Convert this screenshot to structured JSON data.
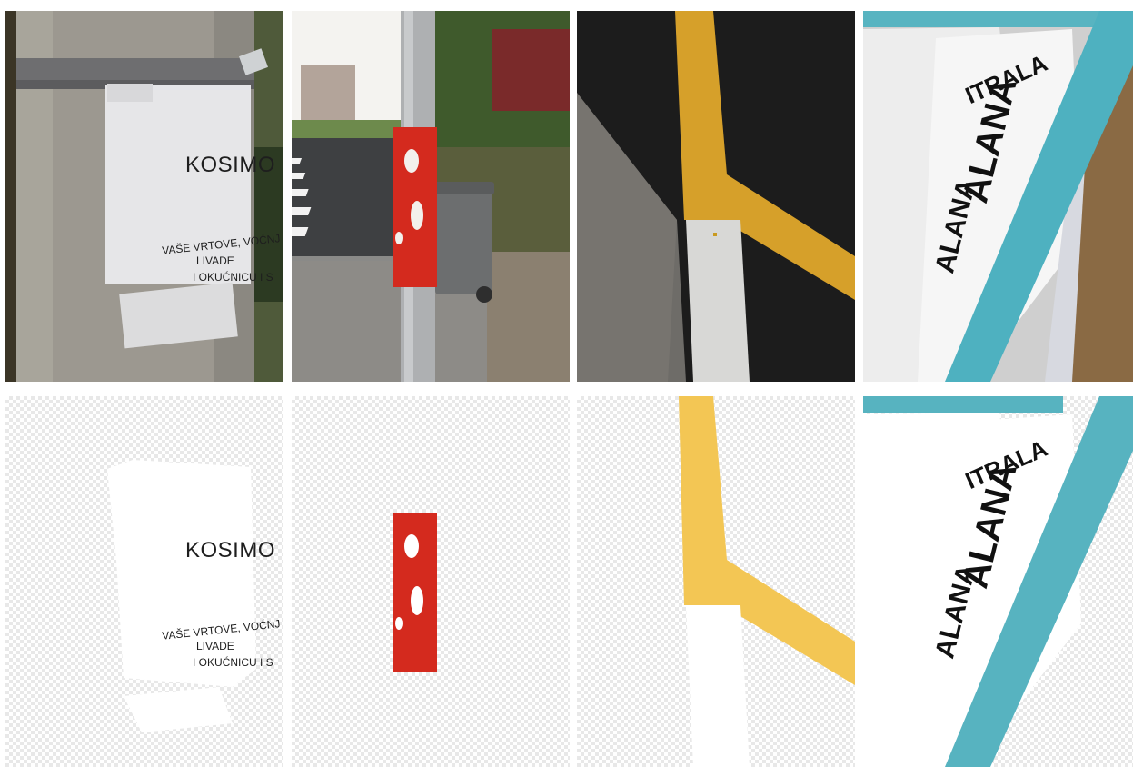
{
  "grid": {
    "photos": [
      {
        "name": "photo-poster-pole"
      },
      {
        "name": "photo-red-pole"
      },
      {
        "name": "photo-road-markings"
      },
      {
        "name": "photo-insulation-packs"
      }
    ],
    "masks": [
      {
        "name": "mask-poster"
      },
      {
        "name": "mask-red-sticker"
      },
      {
        "name": "mask-road-lines"
      },
      {
        "name": "mask-insulation"
      }
    ]
  },
  "poster": {
    "title": "KOSIMO",
    "line1": "VAŠE VRTOVE, VOĆNJ",
    "line2": "LIVADE",
    "line3": "I OKUĆNICU I S"
  },
  "insulation": {
    "word1": "ALANA",
    "word2": "ITRALA",
    "word3": "ALANA"
  },
  "colors": {
    "mask_red": "#d42a1e",
    "mask_yellow": "#f3c654",
    "mask_teal": "#57b3c0",
    "mask_white": "#ffffff"
  }
}
